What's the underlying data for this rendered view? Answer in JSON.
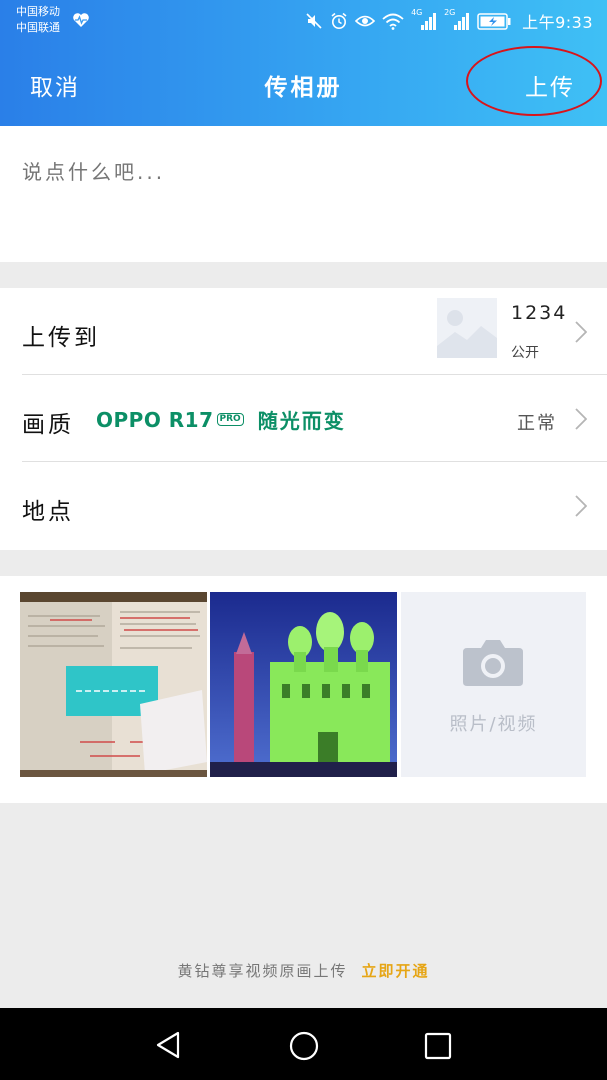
{
  "status_bar": {
    "carrier_1": "中国移动",
    "carrier_2": "中国联通",
    "network_1": "4G",
    "network_2": "2G",
    "time": "上午9:33",
    "icons": [
      "heart-icon",
      "mute-icon",
      "alarm-icon",
      "eye-icon",
      "wifi-icon",
      "signal-icon",
      "battery-icon"
    ]
  },
  "header": {
    "cancel_label": "取消",
    "title": "传相册",
    "upload_label": "上传",
    "annotation_color": "#d8141b"
  },
  "compose": {
    "placeholder": "说点什么吧..."
  },
  "settings": {
    "upload_to": {
      "label": "上传到",
      "album_name": "1234",
      "album_privacy": "公开"
    },
    "quality": {
      "label": "画质",
      "brand_model": "OPPO R17",
      "brand_badge": "PRO",
      "brand_slogan": "随光而变",
      "value": "正常"
    },
    "location": {
      "label": "地点"
    }
  },
  "media": {
    "photos": [
      {
        "name": "document-photo"
      },
      {
        "name": "ice-castle-photo"
      }
    ],
    "add_label": "照片/视频"
  },
  "promo": {
    "text": "黄钻尊享视频原画上传",
    "link": "立即开通"
  },
  "colors": {
    "header_gradient_start": "#2a7fe8",
    "header_gradient_end": "#3fc0f5",
    "brand_green": "#0c8f66",
    "promo_gold": "#e6a515"
  }
}
